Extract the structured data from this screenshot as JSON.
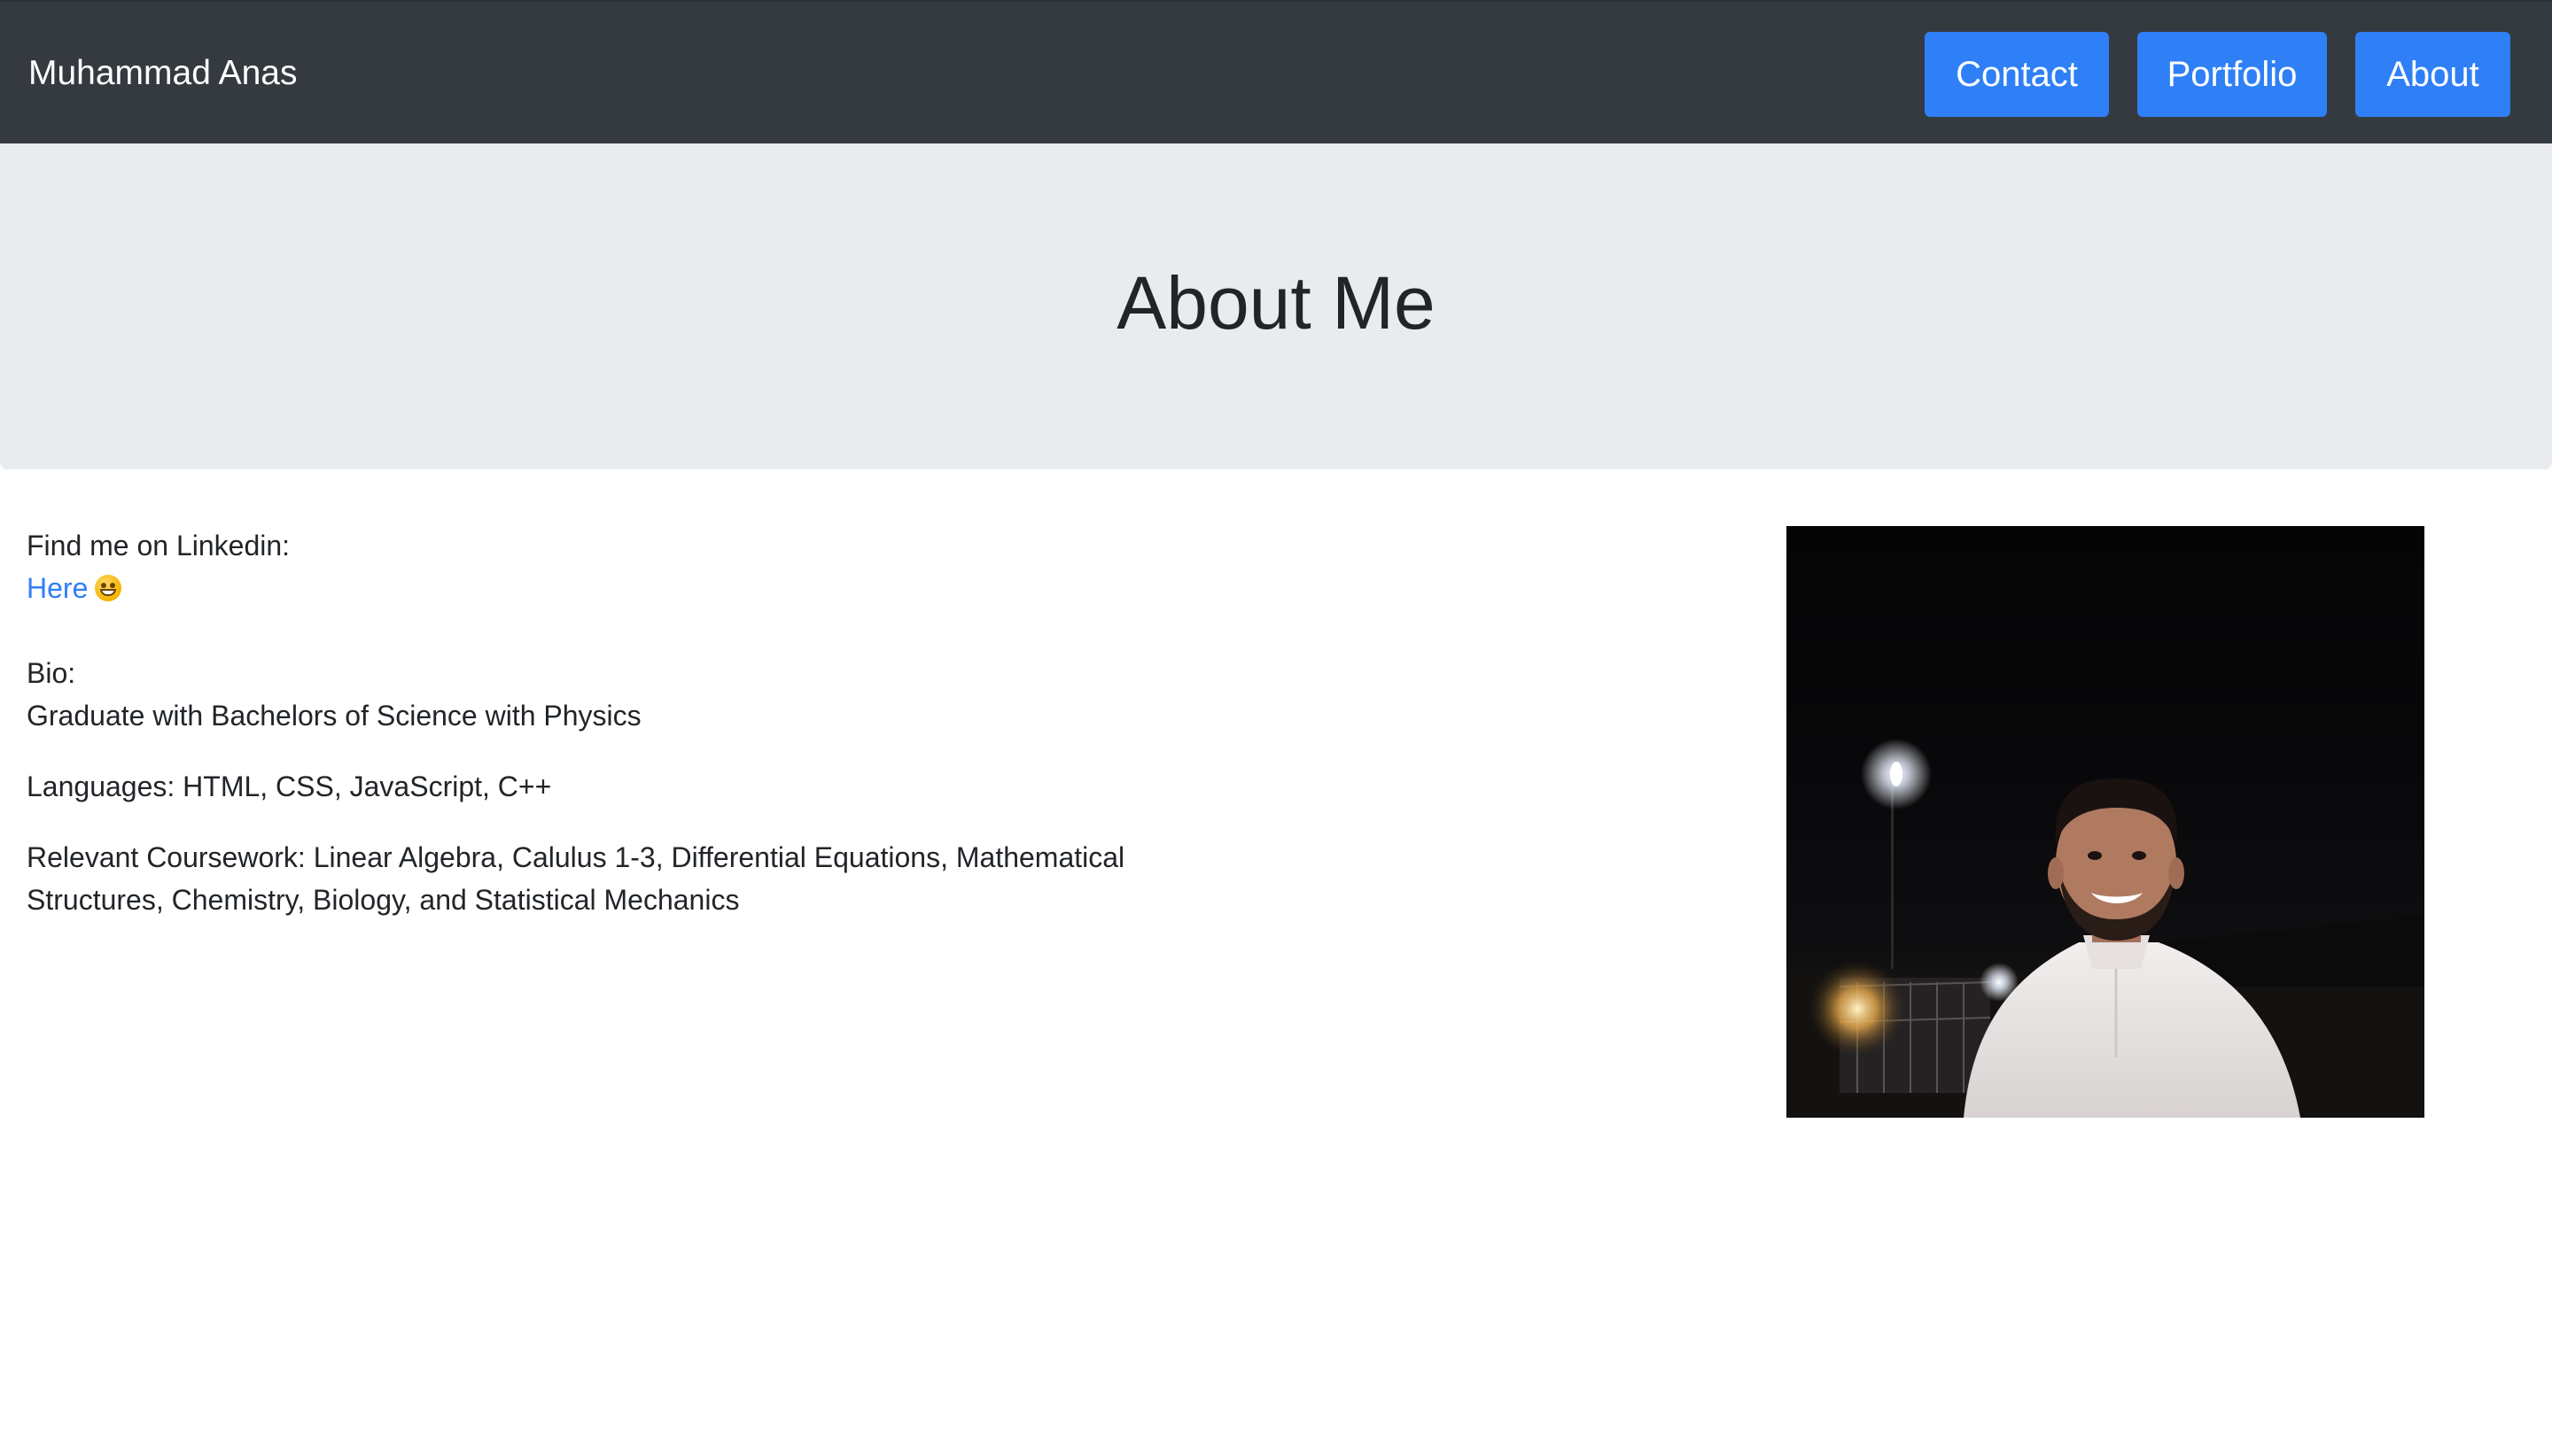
{
  "navbar": {
    "brand": "Muhammad Anas",
    "links": [
      {
        "label": "Contact"
      },
      {
        "label": "Portfolio"
      },
      {
        "label": "About"
      }
    ],
    "colors": {
      "background": "#343a40",
      "button": "#2f7ff7"
    }
  },
  "jumbotron": {
    "title": "About Me",
    "background": "#e9ecef"
  },
  "content": {
    "linkedin_label": "Find me on Linkedin:",
    "linkedin_link": "Here",
    "linkedin_emoji": "grinning-face-icon",
    "bio_label": "Bio:",
    "bio_text": "Graduate with Bachelors of Science with Physics",
    "languages": "Languages: HTML, CSS, JavaScript, C++",
    "coursework": "Relevant Coursework: Linear Algebra, Calulus 1-3, Differential Equations, Mathematical Structures, Chemistry, Biology, and Statistical Mechanics"
  }
}
